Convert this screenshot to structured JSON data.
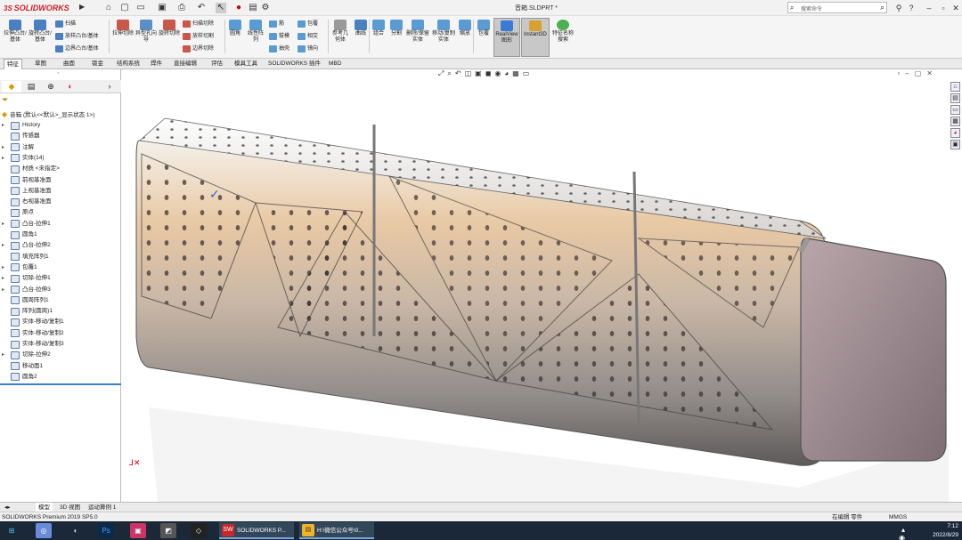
{
  "app": {
    "brand": "SOLIDWORKS",
    "document_title": "音箱.SLDPRT *"
  },
  "search": {
    "placeholder": "搜索命令"
  },
  "ribbon": {
    "big_buttons": [
      {
        "label": "拉伸凸台/基体",
        "color": "#4a7fc1"
      },
      {
        "label": "旋转凸台/基体",
        "color": "#4a7fc1"
      },
      {
        "label": "拉伸切除",
        "color": "#c9574a"
      },
      {
        "label": "异型孔向导",
        "color": "#5b8fc7"
      },
      {
        "label": "旋转切除",
        "color": "#c9574a"
      },
      {
        "label": "圆角",
        "color": "#5a9bd4"
      },
      {
        "label": "线性阵列",
        "color": "#5a9bd4"
      },
      {
        "label": "参考几何体",
        "color": "#999999"
      },
      {
        "label": "曲线",
        "color": "#4a7fc1"
      },
      {
        "label": "组合",
        "color": "#5a9bd4"
      },
      {
        "label": "分割",
        "color": "#5a9bd4"
      },
      {
        "label": "删除/保留实体",
        "color": "#5a9bd4"
      },
      {
        "label": "移动/复制实体",
        "color": "#5a9bd4"
      },
      {
        "label": "缩放",
        "color": "#5a9bd4"
      },
      {
        "label": "包覆",
        "color": "#5a9bd4"
      },
      {
        "label": "RealView 图形",
        "color": "#3a7bd5"
      },
      {
        "label": "Instant3D",
        "color": "#d8a030"
      },
      {
        "label": "特征名称搜索",
        "color": "#4caf50"
      }
    ],
    "small_buttons": [
      {
        "label": "扫描",
        "color": "#4a7fc1"
      },
      {
        "label": "放样凸台/基体",
        "color": "#4a7fc1"
      },
      {
        "label": "边界凸台/基体",
        "color": "#4a7fc1"
      },
      {
        "label": "扫描切除",
        "color": "#c9574a"
      },
      {
        "label": "放样切割",
        "color": "#c9574a"
      },
      {
        "label": "边界切除",
        "color": "#c9574a"
      },
      {
        "label": "筋",
        "color": "#5a9bd4"
      },
      {
        "label": "拔模",
        "color": "#5a9bd4"
      },
      {
        "label": "抽壳",
        "color": "#5a9bd4"
      },
      {
        "label": "包覆",
        "color": "#5a9bd4"
      },
      {
        "label": "相交",
        "color": "#5a9bd4"
      },
      {
        "label": "镜向",
        "color": "#5a9bd4"
      }
    ]
  },
  "command_tabs": [
    "特征",
    "草图",
    "曲面",
    "钣金",
    "结构系统",
    "焊件",
    "直接编辑",
    "评估",
    "模具工具",
    "SOLIDWORKS 插件",
    "MBD"
  ],
  "feature_tree": {
    "root": "音箱 (默认<<默认>_显示状态 1>)",
    "items": [
      {
        "label": "History",
        "expandable": true
      },
      {
        "label": "传感器",
        "expandable": false
      },
      {
        "label": "注解",
        "expandable": true
      },
      {
        "label": "实体(14)",
        "expandable": true
      },
      {
        "label": "材质 <未指定>",
        "expandable": false
      },
      {
        "label": "前视基准面",
        "expandable": false
      },
      {
        "label": "上视基准面",
        "expandable": false
      },
      {
        "label": "右视基准面",
        "expandable": false
      },
      {
        "label": "原点",
        "expandable": false
      },
      {
        "label": "凸台-拉伸1",
        "expandable": true
      },
      {
        "label": "圆角1",
        "expandable": false
      },
      {
        "label": "凸台-拉伸2",
        "expandable": true
      },
      {
        "label": "填充阵列1",
        "expandable": false
      },
      {
        "label": "包覆1",
        "expandable": true
      },
      {
        "label": "切除-拉伸1",
        "expandable": true
      },
      {
        "label": "凸台-拉伸3",
        "expandable": true
      },
      {
        "label": "圆周阵列1",
        "expandable": false
      },
      {
        "label": "阵列(圆周)1",
        "expandable": false
      },
      {
        "label": "实体-移动/复制1",
        "expandable": false
      },
      {
        "label": "实体-移动/复制2",
        "expandable": false
      },
      {
        "label": "实体-移动/复制3",
        "expandable": false
      },
      {
        "label": "切除-拉伸2",
        "expandable": true
      },
      {
        "label": "移动面1",
        "expandable": false
      },
      {
        "label": "圆角2",
        "expandable": false
      }
    ]
  },
  "bottom_tabs": [
    "模型",
    "3D 视图",
    "运动算例 1"
  ],
  "status": {
    "product": "SOLIDWORKS Premium 2019 SP5.0",
    "mode": "在编辑 零件",
    "units": "MMGS"
  },
  "taskbar": {
    "apps": [
      {
        "label": "SOLIDWORKS P...",
        "icon": "SW",
        "color": "#c62828"
      },
      {
        "label": "H:\\微信公众号\\0...",
        "icon": "▤",
        "color": "#f0b429"
      }
    ],
    "time": "7:12",
    "date": "2022/8/29"
  }
}
